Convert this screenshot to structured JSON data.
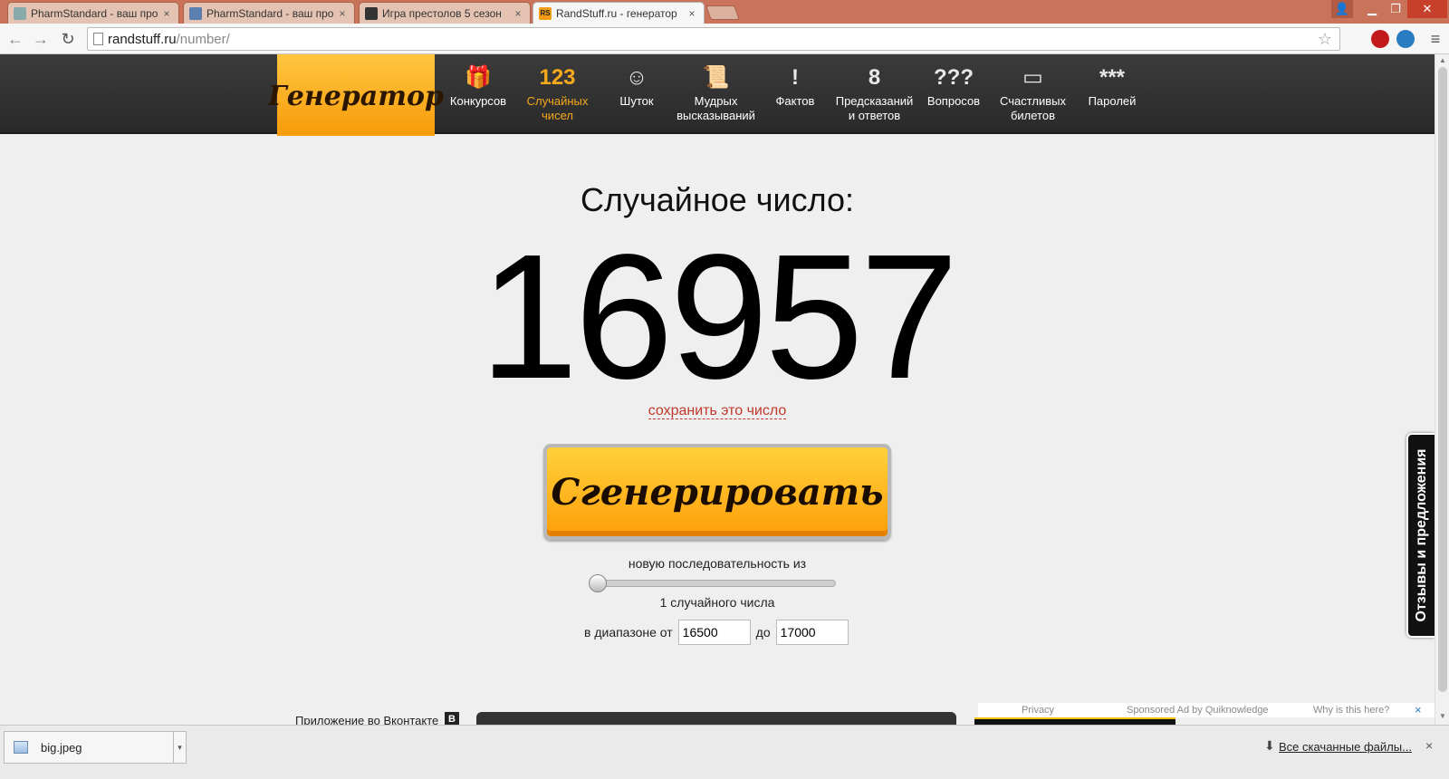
{
  "browser": {
    "tabs": [
      {
        "title": "PharmStandard - ваш про",
        "active": false
      },
      {
        "title": "PharmStandard - ваш про",
        "active": false
      },
      {
        "title": "Игра престолов 5 сезон ",
        "active": false
      },
      {
        "title": "RandStuff.ru - генератор",
        "active": true
      }
    ],
    "tab_close_glyph": "×",
    "active_favicon_text": "RS",
    "address": {
      "host": "randstuff.ru",
      "path": "/number/"
    }
  },
  "site": {
    "logo_text": "Генератор",
    "nav": [
      {
        "icon": "gift-icon",
        "glyph": "🎁",
        "label": "Конкурсов",
        "active": false
      },
      {
        "icon": "numbers-icon",
        "glyph": "123",
        "label": "Случайных чисел",
        "active": true
      },
      {
        "icon": "smiley-icon",
        "glyph": "☺",
        "label": "Шуток",
        "active": false
      },
      {
        "icon": "scroll-icon",
        "glyph": "📜",
        "label": "Мудрых высказываний",
        "active": false
      },
      {
        "icon": "warning-icon",
        "glyph": "!",
        "label": "Фактов",
        "active": false
      },
      {
        "icon": "eight-ball-icon",
        "glyph": "8",
        "label": "Предсказаний и ответов",
        "active": false
      },
      {
        "icon": "questions-icon",
        "glyph": "???",
        "label": "Вопросов",
        "active": false
      },
      {
        "icon": "ticket-icon",
        "glyph": "▭",
        "label": "Счастливых билетов",
        "active": false
      },
      {
        "icon": "password-icon",
        "glyph": "***",
        "label": "Паролей",
        "active": false
      }
    ]
  },
  "result": {
    "label": "Случайное число:",
    "number": "16957",
    "save_link": "сохранить это число"
  },
  "controls": {
    "generate_label": "Сгенерировать",
    "sequence_label": "новую последовательность из",
    "count_label": "1 случайного числа",
    "count_value": 1,
    "range_from_label": "в диапазоне от",
    "range_from": "16500",
    "range_to_label": "до",
    "range_to": "17000"
  },
  "footer": {
    "vk_label": "Приложение во Вконтакте",
    "vk_badge": "В",
    "ad": {
      "privacy": "Privacy",
      "sponsored": "Sponsored Ad by Quiknowledge",
      "why": "Why is this here?",
      "close": "×"
    }
  },
  "feedback_label": "Отзывы и предложения",
  "downloads": {
    "file_name": "big.jpeg",
    "all_downloads": "Все скачанные файлы...",
    "caret": "▾",
    "close": "×"
  },
  "colors": {
    "accent": "#f6a91a",
    "titlebar": "#c9735a",
    "link": "#c0392b"
  }
}
